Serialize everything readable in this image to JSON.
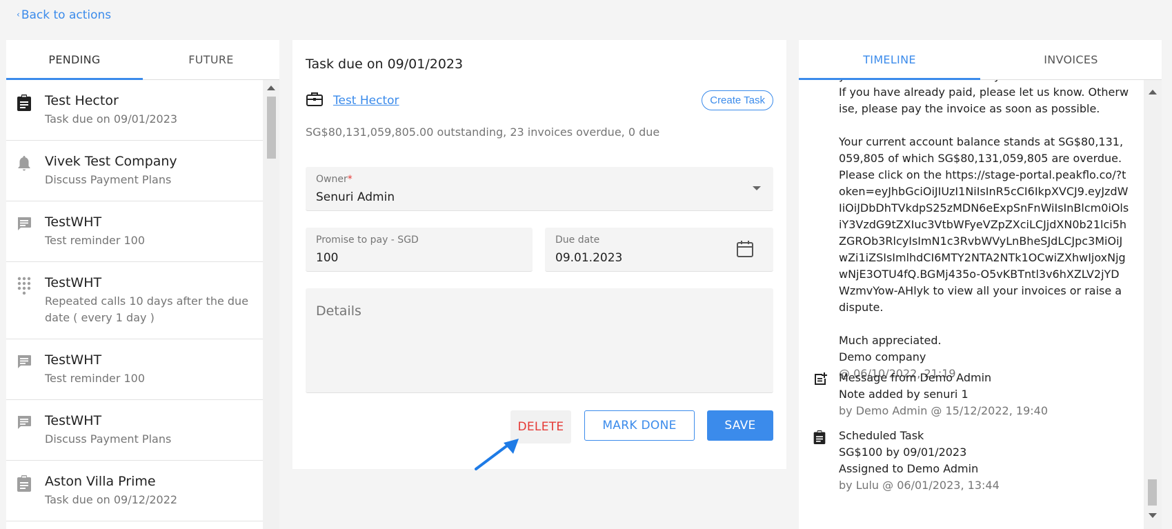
{
  "nav": {
    "back_label": "Back to actions"
  },
  "left": {
    "tabs": [
      "PENDING",
      "FUTURE"
    ],
    "items": [
      {
        "title": "Test Hector",
        "subtitle": "Task due on 09/01/2023",
        "icon": "clipboard-icon"
      },
      {
        "title": "Vivek Test Company",
        "subtitle": "Discuss Payment Plans",
        "icon": "bell-icon"
      },
      {
        "title": "TestWHT",
        "subtitle": "Test reminder 100",
        "icon": "message-icon"
      },
      {
        "title": "TestWHT",
        "subtitle": "Repeated calls 10 days after the due date ( every 1 day )",
        "icon": "dialpad-icon"
      },
      {
        "title": "TestWHT",
        "subtitle": "Test reminder 100",
        "icon": "message-icon"
      },
      {
        "title": "TestWHT",
        "subtitle": "Discuss Payment Plans",
        "icon": "message-icon"
      },
      {
        "title": "Aston Villa Prime",
        "subtitle": "Task due on 09/12/2022",
        "icon": "clipboard-icon"
      }
    ]
  },
  "task": {
    "title": "Task due on 09/01/2023",
    "customer": "Test Hector",
    "create_task_label": "Create Task",
    "outstanding": "SG$80,131,059,805.00 outstanding, 23 invoices overdue, 0 due",
    "owner_label": "Owner",
    "owner_required": "*",
    "owner_value": "Senuri Admin",
    "promise_label": "Promise to pay - SGD",
    "promise_value": "100",
    "due_label": "Due date",
    "due_value": "09.01.2023",
    "details_placeholder": "Details",
    "delete_label": "DELETE",
    "mark_done_label": "MARK DONE",
    "save_label": "SAVE"
  },
  "right": {
    "tabs": [
      "TIMELINE",
      "INVOICES"
    ],
    "message_text": "yment for invoice for is x days overdue.\nIf you have already paid, please let us know. Otherwise, please pay the invoice as soon as possible.\n\nYour current account balance stands at SG$80,131,059,805 of which SG$80,131,059,805 are overdue. Please click on the https://stage-portal.peakflo.co/?token=eyJhbGciOiJIUzI1NiIsInR5cCI6IkpXVCJ9.eyJzdWIiOiJDbDhTVkdpS25zMDN6eExpSnFnWiIsInBlcm0iOlsiY3VzdG9tZXIuc3VtbWFyeVZpZXciLCJjdXN0b21lci5hZGROb3RlcyIsImN1c3RvbWVyLnBheSJdLCJpc3MiOiJwZi1iZSIsImlhdCI6MTY2NTA2NTk1OCwiZXhwIjoxNjgwNjE3OTU4fQ.BGMj435o-O5vKBTntl3v6hXZLV2jYDWzmvYow-AHlyk to view all your invoices or raise a dispute.\n\nMuch appreciated.\nDemo company",
    "message_meta": "@ 06/10/2022, 21:19",
    "entries": [
      {
        "title": "Message from Demo Admin",
        "line2": "Note added by senuri 1",
        "meta": "by Demo Admin @ 15/12/2022, 19:40",
        "icon": "note-add-icon"
      },
      {
        "title": "Scheduled Task",
        "line2": "SG$100 by 09/01/2023",
        "line3": "Assigned to Demo Admin",
        "meta": "by Lulu @ 06/01/2023, 13:44",
        "icon": "clipboard-icon"
      }
    ]
  },
  "colors": {
    "accent": "#3b8beb",
    "danger": "#e53935",
    "muted": "#757575"
  }
}
